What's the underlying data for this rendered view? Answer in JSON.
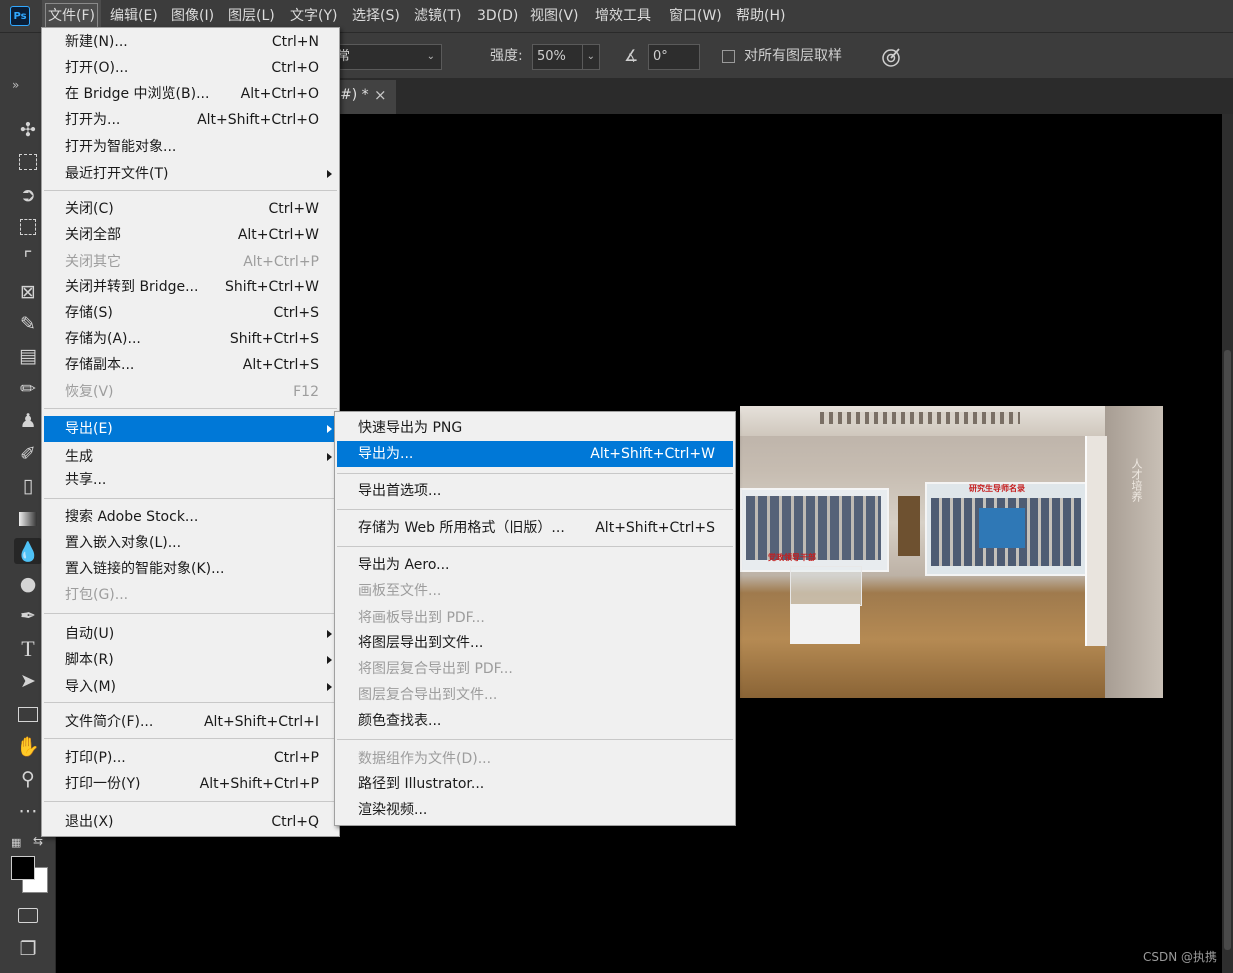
{
  "app": {
    "logo_text": "Ps"
  },
  "menubar": {
    "items": [
      {
        "label": "文件(F)",
        "active": true
      },
      {
        "label": "编辑(E)"
      },
      {
        "label": "图像(I)"
      },
      {
        "label": "图层(L)"
      },
      {
        "label": "文字(Y)"
      },
      {
        "label": "选择(S)"
      },
      {
        "label": "滤镜(T)"
      },
      {
        "label": "3D(D)"
      },
      {
        "label": "视图(V)"
      },
      {
        "label": "增效工具"
      },
      {
        "label": "窗口(W)"
      },
      {
        "label": "帮助(H)"
      }
    ]
  },
  "options_bar": {
    "mode_value": "常",
    "strength_label": "强度:",
    "strength_value": "50%",
    "angle_value": "0°",
    "sample_all_label": "对所有图层取样"
  },
  "document_tab": {
    "title_fragment": "#) *",
    "close_glyph": "×"
  },
  "panel_collapse_glyph": "»",
  "file_menu": {
    "items": [
      {
        "label": "新建(N)...",
        "shortcut": "Ctrl+N"
      },
      {
        "label": "打开(O)...",
        "shortcut": "Ctrl+O"
      },
      {
        "label": "在 Bridge 中浏览(B)...",
        "shortcut": "Alt+Ctrl+O"
      },
      {
        "label": "打开为...",
        "shortcut": "Alt+Shift+Ctrl+O"
      },
      {
        "label": "打开为智能对象..."
      },
      {
        "label": "最近打开文件(T)",
        "submenu": true
      },
      {
        "label": "关闭(C)",
        "shortcut": "Ctrl+W"
      },
      {
        "label": "关闭全部",
        "shortcut": "Alt+Ctrl+W"
      },
      {
        "label": "关闭其它",
        "shortcut": "Alt+Ctrl+P",
        "disabled": true
      },
      {
        "label": "关闭并转到 Bridge...",
        "shortcut": "Shift+Ctrl+W"
      },
      {
        "label": "存储(S)",
        "shortcut": "Ctrl+S"
      },
      {
        "label": "存储为(A)...",
        "shortcut": "Shift+Ctrl+S"
      },
      {
        "label": "存储副本...",
        "shortcut": "Alt+Ctrl+S"
      },
      {
        "label": "恢复(V)",
        "shortcut": "F12",
        "disabled": true
      },
      {
        "label": "导出(E)",
        "submenu": true,
        "highlighted": true
      },
      {
        "label": "生成",
        "submenu": true
      },
      {
        "label": "共享..."
      },
      {
        "label": "搜索 Adobe Stock..."
      },
      {
        "label": "置入嵌入对象(L)..."
      },
      {
        "label": "置入链接的智能对象(K)..."
      },
      {
        "label": "打包(G)...",
        "disabled": true
      },
      {
        "label": "自动(U)",
        "submenu": true
      },
      {
        "label": "脚本(R)",
        "submenu": true
      },
      {
        "label": "导入(M)",
        "submenu": true
      },
      {
        "label": "文件简介(F)...",
        "shortcut": "Alt+Shift+Ctrl+I"
      },
      {
        "label": "打印(P)...",
        "shortcut": "Ctrl+P"
      },
      {
        "label": "打印一份(Y)",
        "shortcut": "Alt+Shift+Ctrl+P"
      },
      {
        "label": "退出(X)",
        "shortcut": "Ctrl+Q"
      }
    ]
  },
  "export_submenu": {
    "items": [
      {
        "label": "快速导出为 PNG"
      },
      {
        "label": "导出为...",
        "shortcut": "Alt+Shift+Ctrl+W",
        "highlighted": true
      },
      {
        "label": "导出首选项..."
      },
      {
        "label": "存储为 Web 所用格式（旧版）...",
        "shortcut": "Alt+Shift+Ctrl+S"
      },
      {
        "label": "导出为 Aero..."
      },
      {
        "label": "画板至文件...",
        "disabled": true
      },
      {
        "label": "将画板导出到 PDF...",
        "disabled": true
      },
      {
        "label": "将图层导出到文件..."
      },
      {
        "label": "将图层复合导出到 PDF...",
        "disabled": true
      },
      {
        "label": "图层复合导出到文件...",
        "disabled": true
      },
      {
        "label": "颜色查找表..."
      },
      {
        "label": "数据组作为文件(D)...",
        "disabled": true
      },
      {
        "label": "路径到 Illustrator..."
      },
      {
        "label": "渲染视频..."
      }
    ]
  },
  "canvas_image": {
    "sign_text": "人才培养",
    "banner_left": "党政领导干部",
    "banner_right": "研究生导师名录"
  },
  "watermark": "CSDN @执携",
  "colors": {
    "highlight": "#0078d7",
    "menu_bg": "#f0f0f0",
    "chrome": "#3c3c3c",
    "canvas": "#000000"
  }
}
